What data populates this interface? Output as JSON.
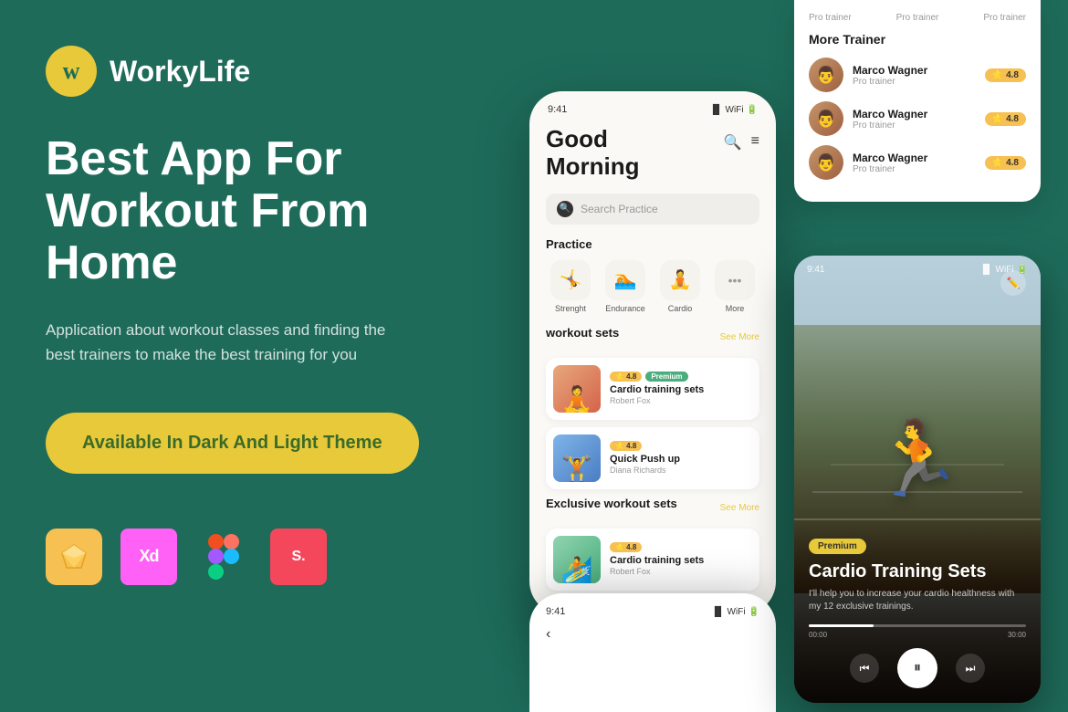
{
  "brand": {
    "logo_letter": "w",
    "name": "WorkyLife"
  },
  "hero": {
    "headline": "Best App For Workout From Home",
    "subtext": "Application about workout classes and finding the best trainers to make the best training for you",
    "cta": "Available In Dark And Light Theme"
  },
  "tools": [
    {
      "name": "sketch",
      "label": "Sketch",
      "icon": "⬡"
    },
    {
      "name": "xd",
      "label": "Adobe XD",
      "icon": "Xd"
    },
    {
      "name": "figma",
      "label": "Figma",
      "icon": "figma"
    },
    {
      "name": "slides",
      "label": "Slides",
      "icon": "S."
    }
  ],
  "phone": {
    "status_time": "9:41",
    "greeting": "Good Morning",
    "search_placeholder": "Search Practice",
    "practice_label": "Practice",
    "practice_items": [
      {
        "label": "Strenght",
        "emoji": "🤸"
      },
      {
        "label": "Endurance",
        "emoji": "🏊"
      },
      {
        "label": "Cardio",
        "emoji": "🧘"
      },
      {
        "label": "More",
        "emoji": "···"
      }
    ],
    "workout_sets_label": "workout sets",
    "see_more": "See More",
    "workout_items": [
      {
        "title": "Cardio training sets",
        "trainer": "Robert Fox",
        "rating": "4.8",
        "premium": true
      },
      {
        "title": "Quick Push up",
        "trainer": "Diana Richards",
        "rating": "4.8",
        "premium": false
      }
    ],
    "exclusive_label": "Exclusive workout sets",
    "exclusive_items": [
      {
        "title": "Cardio training sets",
        "trainer": "Robert Fox",
        "rating": "4.8",
        "premium": false
      }
    ]
  },
  "trainer_panel": {
    "top_labels": [
      "Pro trainer",
      "Pro trainer",
      "Pro trainer"
    ],
    "title": "More Trainer",
    "trainers": [
      {
        "name": "Marco Wagner",
        "role": "Pro trainer",
        "rating": "4.8"
      },
      {
        "name": "Marco Wagner",
        "role": "Pro trainer",
        "rating": "4.8"
      },
      {
        "name": "Marco Wagner",
        "role": "Pro trainer",
        "rating": "4.8"
      }
    ]
  },
  "video_card": {
    "status_time": "9:41",
    "premium_badge": "Premium",
    "title": "Cardio Training Sets",
    "desc": "I'll help you to increase your cardio healthness with my 12 exclusive trainings.",
    "time_current": "00:00",
    "time_total": "30:00"
  },
  "colors": {
    "bg": "#1e6b5a",
    "accent": "#e8c93a",
    "premium_green": "#4aad7c"
  }
}
